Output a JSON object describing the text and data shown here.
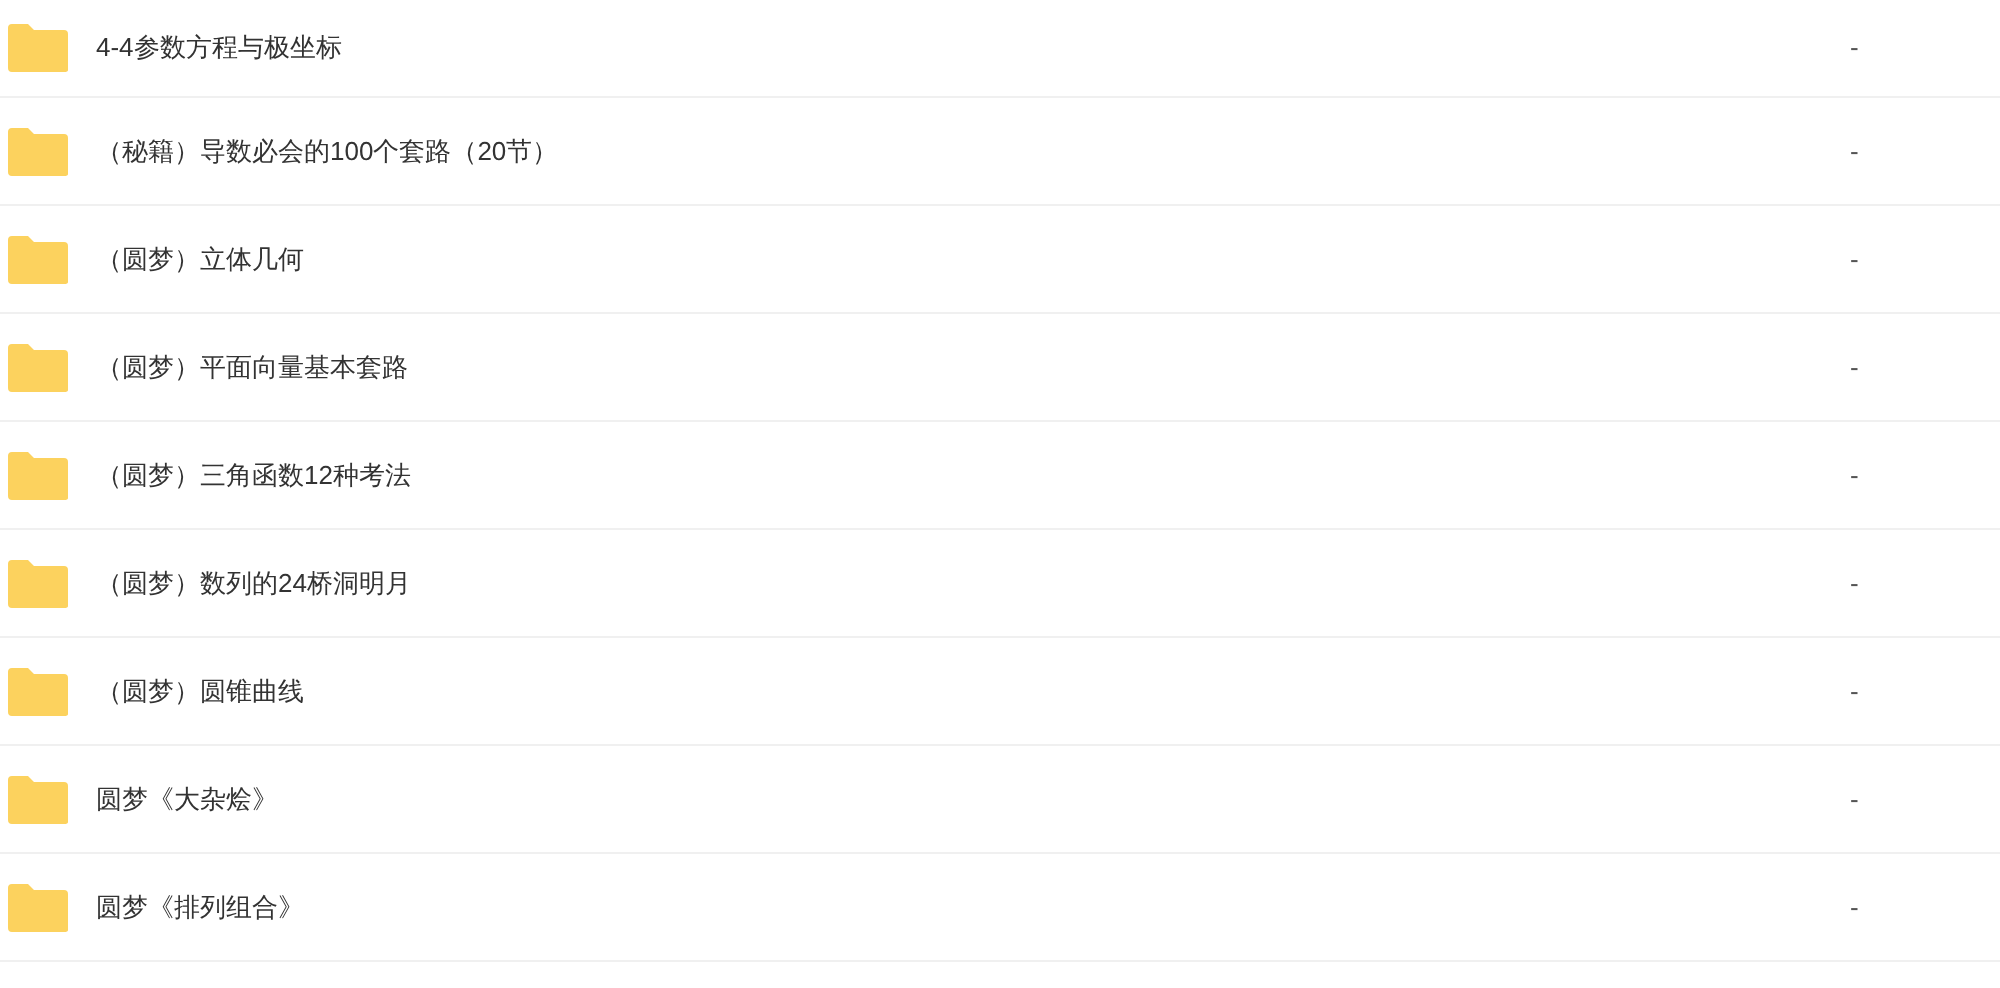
{
  "files": [
    {
      "name": "4-4参数方程与极坐标",
      "size": "-"
    },
    {
      "name": "（秘籍）导数必会的100个套路（20节）",
      "size": "-"
    },
    {
      "name": "（圆梦）立体几何",
      "size": "-"
    },
    {
      "name": "（圆梦）平面向量基本套路",
      "size": "-"
    },
    {
      "name": "（圆梦）三角函数12种考法",
      "size": "-"
    },
    {
      "name": "（圆梦）数列的24桥洞明月",
      "size": "-"
    },
    {
      "name": "（圆梦）圆锥曲线",
      "size": "-"
    },
    {
      "name": "圆梦《大杂烩》",
      "size": "-"
    },
    {
      "name": "圆梦《排列组合》",
      "size": "-"
    }
  ]
}
